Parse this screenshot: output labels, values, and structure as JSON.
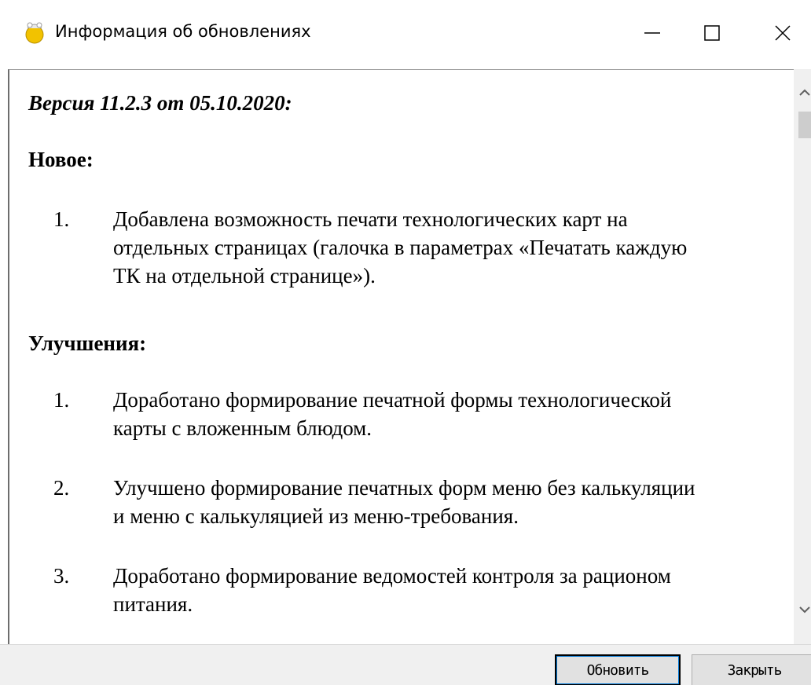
{
  "window": {
    "title": "Информация об обновлениях",
    "icon": "app-update-icon",
    "controls": {
      "minimize_icon": "minimize-icon",
      "maximize_icon": "maximize-icon",
      "close_icon": "close-icon"
    }
  },
  "content": {
    "version_heading": "Версия 11.2.3 от 05.10.2020:",
    "new_section": {
      "heading": "Новое:",
      "items": [
        {
          "number": "1.",
          "lines": [
            "Добавлена возможность печати технологических карт на",
            "отдельных страницах (галочка в параметрах «Печатать каждую",
            "ТК на отдельной странице»)."
          ]
        }
      ]
    },
    "improvements_section": {
      "heading": "Улучшения:",
      "items": [
        {
          "number": "1.",
          "lines": [
            "Доработано формирование печатной формы технологической",
            "карты с вложенным блюдом."
          ]
        },
        {
          "number": "2.",
          "lines": [
            "Улучшено формирование печатных форм меню без калькуляции",
            "и меню с калькуляцией из меню-требования."
          ]
        },
        {
          "number": "3.",
          "lines": [
            "Доработано формирование ведомостей контроля за рационом",
            "питания."
          ]
        }
      ]
    }
  },
  "buttons": {
    "update_label": "Обновить",
    "close_label": "Закрыть"
  },
  "colors": {
    "focus_border": "#0078d7",
    "button_bg": "#e1e1e1",
    "bar_bg": "#f0f0f0"
  }
}
